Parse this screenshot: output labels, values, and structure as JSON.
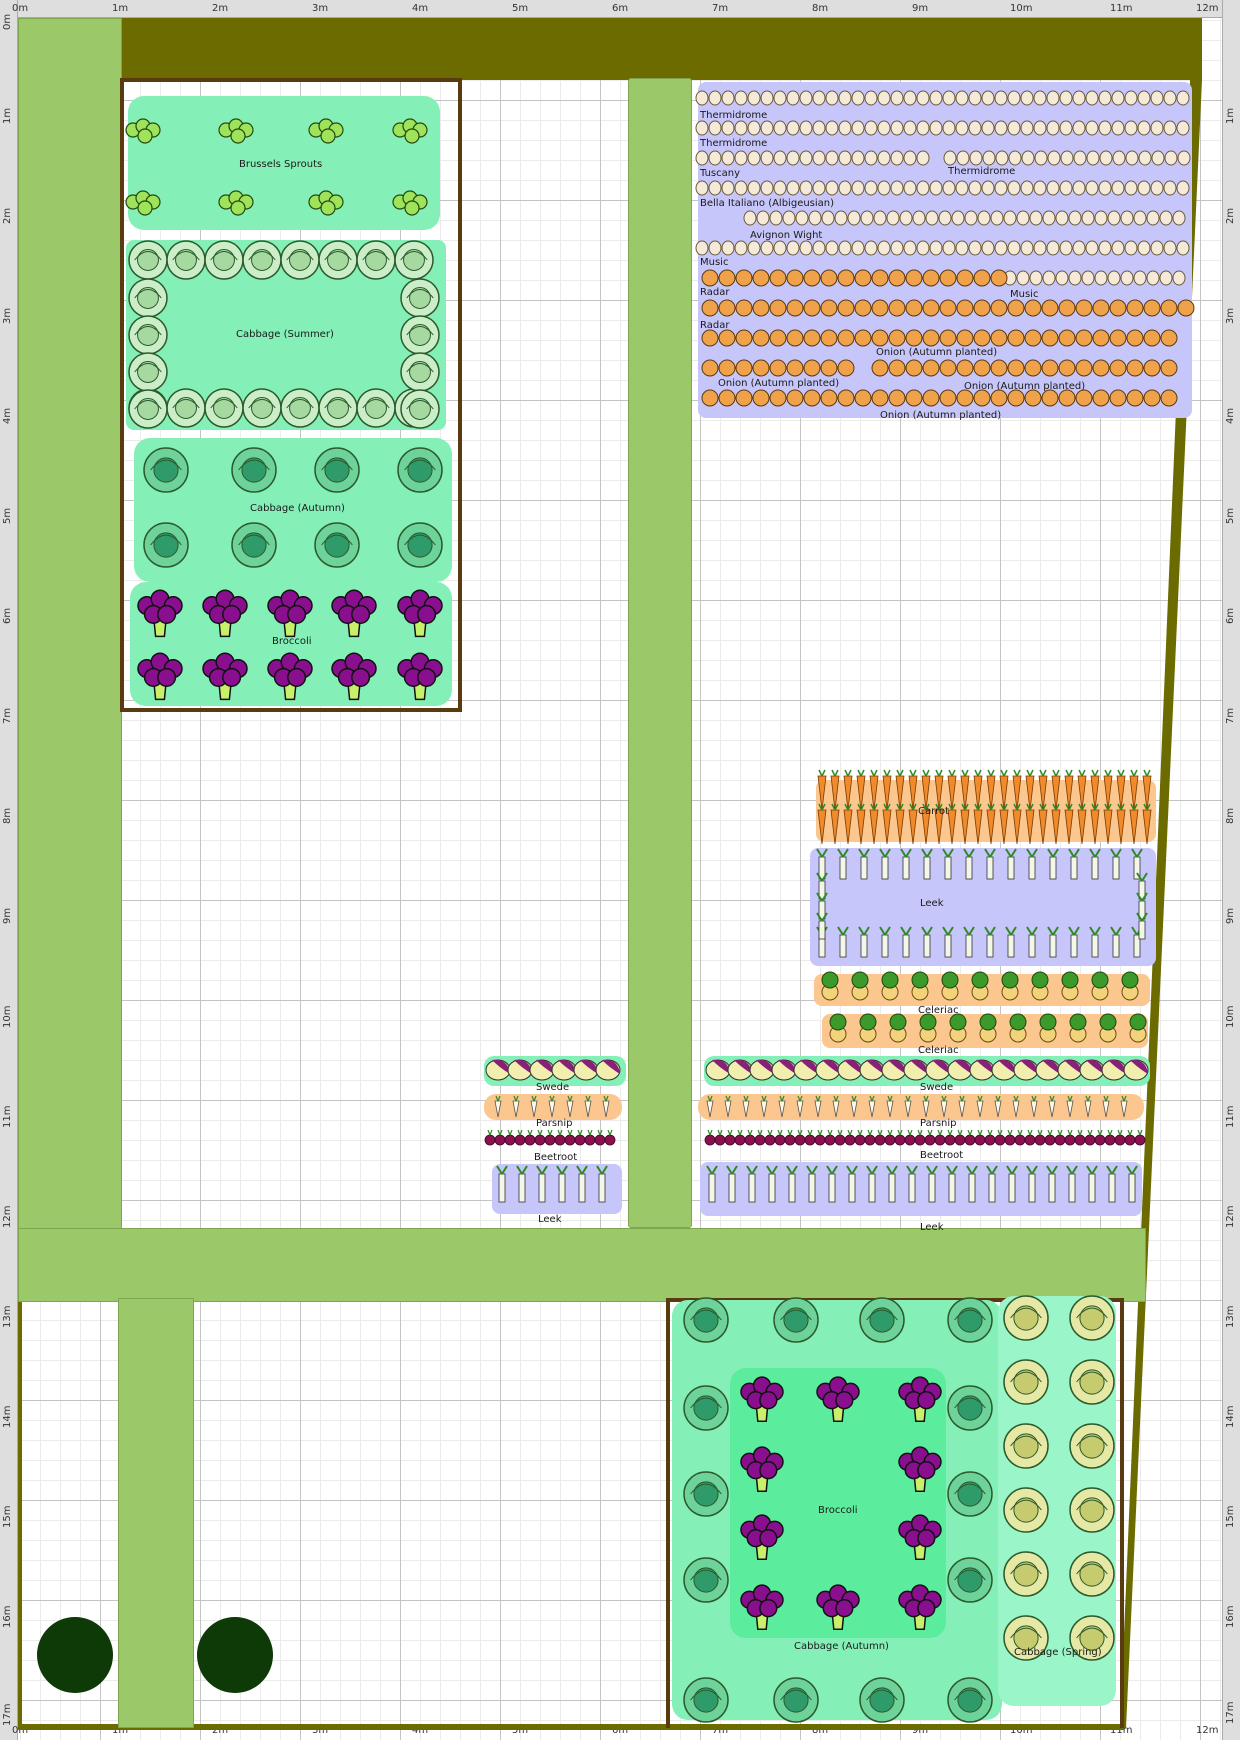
{
  "ruler": {
    "x_labels": [
      "0m",
      "1m",
      "2m",
      "3m",
      "4m",
      "5m",
      "6m",
      "7m",
      "8m",
      "9m",
      "10m",
      "11m",
      "12m"
    ],
    "y_labels": [
      "0m",
      "1m",
      "2m",
      "3m",
      "4m",
      "5m",
      "6m",
      "7m",
      "8m",
      "9m",
      "10m",
      "11m",
      "12m",
      "13m",
      "14m",
      "15m",
      "16m",
      "17m"
    ]
  },
  "colors": {
    "path": "#9bc96a",
    "hedge": "#6b6b00",
    "fence": "#5a3a10",
    "bed_green": "#84f0b8",
    "bed_blue": "#c6c6fb",
    "bed_orange": "#fbc78e",
    "tree": "#0d3a06"
  },
  "beds": {
    "brussels": "Brussels Sprouts",
    "cabbage_summer": "Cabbage (Summer)",
    "cabbage_autumn_top": "Cabbage (Autumn)",
    "broccoli_top": "Broccoli",
    "onion_rows": [
      "Thermidrome",
      "Thermidrome",
      "Tuscany",
      "Thermidrome",
      "Bella Italiano (Albigeusian)",
      "Avignon Wight",
      "Music",
      "Radar",
      "Music",
      "Radar",
      "Onion (Autumn planted)",
      "Onion (Autumn planted)",
      "Onion (Autumn planted)",
      "Onion (Autumn planted)"
    ],
    "carrot": "Carrot",
    "leek_large": "Leek",
    "celeriac_1": "Celeriac",
    "celeriac_2": "Celeriac",
    "swede_left": "Swede",
    "parsnip_left": "Parsnip",
    "beetroot_left": "Beetroot",
    "leek_left": "Leek",
    "swede_right": "Swede",
    "parsnip_right": "Parsnip",
    "beetroot_right": "Beetroot",
    "leek_right": "Leek",
    "broccoli_bottom": "Broccoli",
    "cabbage_autumn_bottom": "Cabbage (Autumn)",
    "cabbage_spring": "Cabbage (Spring)"
  },
  "plant_icons": [
    "brussels-sprout-icon",
    "cabbage-icon",
    "broccoli-icon",
    "onion-icon",
    "garlic-icon",
    "carrot-icon",
    "leek-icon",
    "celeriac-icon",
    "swede-icon",
    "parsnip-icon",
    "beetroot-icon",
    "tree-icon"
  ]
}
